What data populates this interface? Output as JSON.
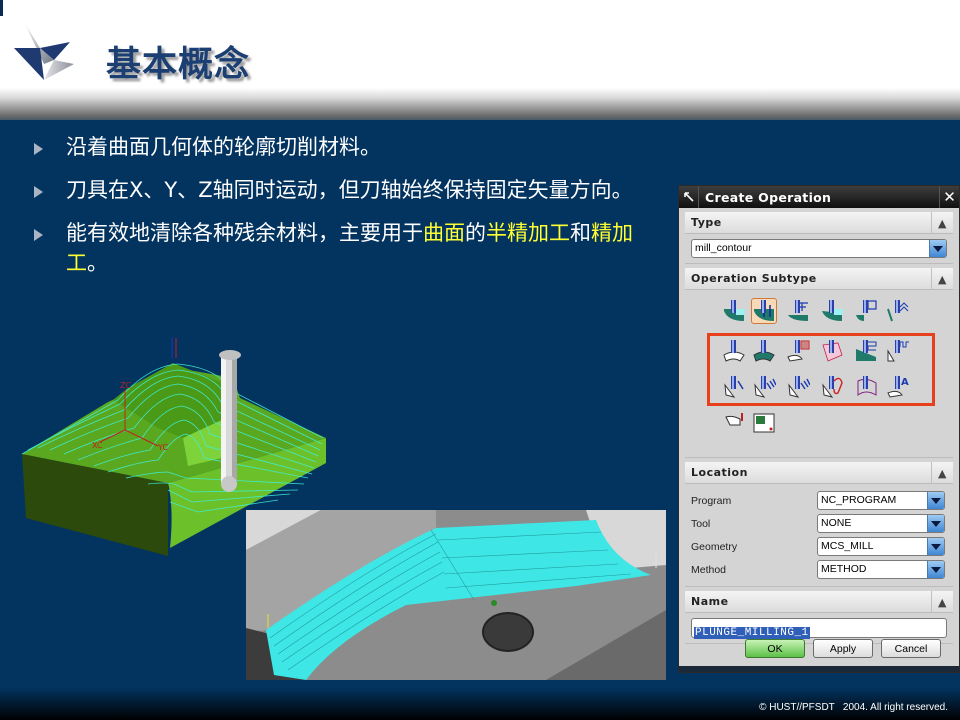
{
  "slide": {
    "title": "基本概念",
    "bullets": [
      {
        "segments": [
          {
            "text": "沿着曲面几何体的轮廓切削材料。",
            "highlight": false
          }
        ]
      },
      {
        "segments": [
          {
            "text": "刀具在X、Y、Z轴同时运动，但刀轴始终保持固定矢量方向。",
            "highlight": false
          }
        ]
      },
      {
        "segments": [
          {
            "text": "能有效地清除各种残余材料，主要用于",
            "highlight": false
          },
          {
            "text": "曲面",
            "highlight": true
          },
          {
            "text": "的",
            "highlight": false
          },
          {
            "text": "半精加工",
            "highlight": true
          },
          {
            "text": "和",
            "highlight": false
          },
          {
            "text": "精加工",
            "highlight": true
          },
          {
            "text": "。",
            "highlight": false
          }
        ]
      }
    ],
    "footer": "© HUST//PFSDT   2004. All right reserved.",
    "colors": {
      "background": "#03335f",
      "title": "#1c3f73",
      "highlight": "#ffff33",
      "annotation_box": "#e8401c"
    }
  },
  "images": {
    "part_model": {
      "label": "3D contour milling toolpath on green part with ball-end tool",
      "axis_labels": [
        "ZC",
        "XC",
        "YC"
      ]
    },
    "surface_model": {
      "label": "Gray part with cyan contour toolpath over curved surface"
    }
  },
  "dialog": {
    "title": "Create Operation",
    "sections": {
      "type": {
        "header": "Type",
        "value": "mill_contour"
      },
      "subtype": {
        "header": "Operation Subtype",
        "icons": [
          {
            "name": "cavity-mill-icon",
            "selected": false
          },
          {
            "name": "plunge-milling-icon",
            "selected": true
          },
          {
            "name": "corner-rough-icon",
            "selected": false
          },
          {
            "name": "rest-milling-icon",
            "selected": false
          },
          {
            "name": "zlevel-profile-icon",
            "selected": false
          },
          {
            "name": "zlevel-corner-icon",
            "selected": false
          },
          {
            "name": "fixed-contour-icon",
            "selected": false
          },
          {
            "name": "contour-area-icon",
            "selected": false
          },
          {
            "name": "contour-surface-area-icon",
            "selected": false
          },
          {
            "name": "streamline-icon",
            "selected": false
          },
          {
            "name": "contour-area-non-steep-icon",
            "selected": false
          },
          {
            "name": "contour-area-dir-steep-icon",
            "selected": false
          },
          {
            "name": "flowcut-single-icon",
            "selected": false
          },
          {
            "name": "flowcut-multiple-icon",
            "selected": false
          },
          {
            "name": "flowcut-ref-tool-icon",
            "selected": false
          },
          {
            "name": "flowcut-smooth-icon",
            "selected": false
          },
          {
            "name": "profile-3d-icon",
            "selected": false
          },
          {
            "name": "contour-text-icon",
            "selected": false
          },
          {
            "name": "mill-user-icon",
            "selected": false
          },
          {
            "name": "mill-control-icon",
            "selected": false
          }
        ]
      },
      "location": {
        "header": "Location",
        "fields": [
          {
            "label": "Program",
            "value": "NC_PROGRAM"
          },
          {
            "label": "Tool",
            "value": "NONE"
          },
          {
            "label": "Geometry",
            "value": "MCS_MILL"
          },
          {
            "label": "Method",
            "value": "METHOD"
          }
        ]
      },
      "name": {
        "header": "Name",
        "value": "PLUNGE_MILLING_1"
      }
    },
    "buttons": {
      "ok": "OK",
      "apply": "Apply",
      "cancel": "Cancel"
    }
  }
}
